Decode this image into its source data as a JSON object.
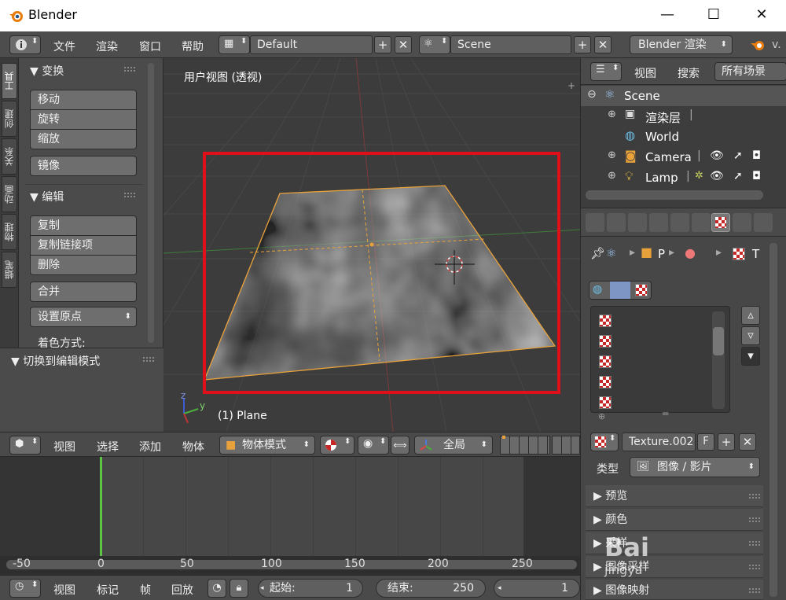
{
  "window": {
    "title": "Blender",
    "minimize": "—",
    "maximize": "☐",
    "close": "✕"
  },
  "info_header": {
    "menus": [
      "文件",
      "渲染",
      "窗口",
      "帮助"
    ],
    "screen_layout": "Default",
    "scene": "Scene",
    "render_engine": "Blender 渲染",
    "version_fragment": "v."
  },
  "shelf_tabs": [
    "工具",
    "创建",
    "关系",
    "动画",
    "物理",
    "蜡笔"
  ],
  "tool_shelf": {
    "transform_title": "▼ 变换",
    "transform_buttons": [
      "移动",
      "旋转",
      "缩放"
    ],
    "mirror": "镜像",
    "edit_title": "▼ 编辑",
    "edit_buttons": [
      "复制",
      "复制链接项",
      "删除"
    ],
    "join": "合并",
    "set_origin": "设置原点",
    "shading_label": "着色方式:",
    "toggle_edit_title": "▼ 切换到编辑模式"
  },
  "viewport": {
    "view_label": "用户视图 (透视)",
    "object_label": "(1) Plane",
    "axis_z": "z",
    "axis_y": "y"
  },
  "viewport_header": {
    "menus": [
      "视图",
      "选择",
      "添加",
      "物体"
    ],
    "mode": "物体模式",
    "orientation": "全局"
  },
  "timeline": {
    "ticks": [
      "-50",
      "0",
      "50",
      "100",
      "150",
      "200",
      "250"
    ],
    "current_frame_marker": 0
  },
  "timeline_header": {
    "menus": [
      "视图",
      "标记",
      "帧",
      "回放"
    ],
    "start_label": "起始:",
    "start_value": "1",
    "end_label": "结束:",
    "end_value": "250",
    "current_frame": "1"
  },
  "outliner": {
    "view_menu": "视图",
    "search_menu": "搜索",
    "filter": "所有场景",
    "items": [
      {
        "label": "Scene",
        "icon": "scene-icon"
      },
      {
        "label": "渲染层",
        "icon": "render-layer-icon"
      },
      {
        "label": "World",
        "icon": "world-icon"
      },
      {
        "label": "Camera",
        "icon": "camera-icon"
      },
      {
        "label": "Lamp",
        "icon": "lamp-icon"
      }
    ]
  },
  "properties": {
    "breadcrumb_p": "P",
    "breadcrumb_t": "T",
    "texture_name": "Texture.002",
    "fake_user": "F",
    "type_label": "类型",
    "type_value": "图像 / 影片",
    "panels": [
      "▶ 预览",
      "▶ 颜色",
      "▶ 采样",
      "▶ 图像采样",
      "▶ 图像映射"
    ]
  },
  "watermark": {
    "line1": "Bai",
    "line2": "jingya"
  },
  "colors": {
    "accent_orange": "#e9a23b",
    "highlight_red": "#e0101a",
    "frame_green": "#5cc644"
  }
}
